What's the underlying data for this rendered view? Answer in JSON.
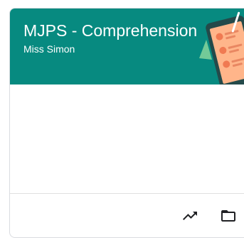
{
  "class_card": {
    "title": "MJPS - Comprehension",
    "teacher": "Miss Simon",
    "header_color": "#078a80",
    "illustration": "tablet-reading-illustration",
    "actions": [
      {
        "icon": "trending-up-icon",
        "tooltip": ""
      },
      {
        "icon": "folder-icon",
        "tooltip": ""
      }
    ]
  }
}
